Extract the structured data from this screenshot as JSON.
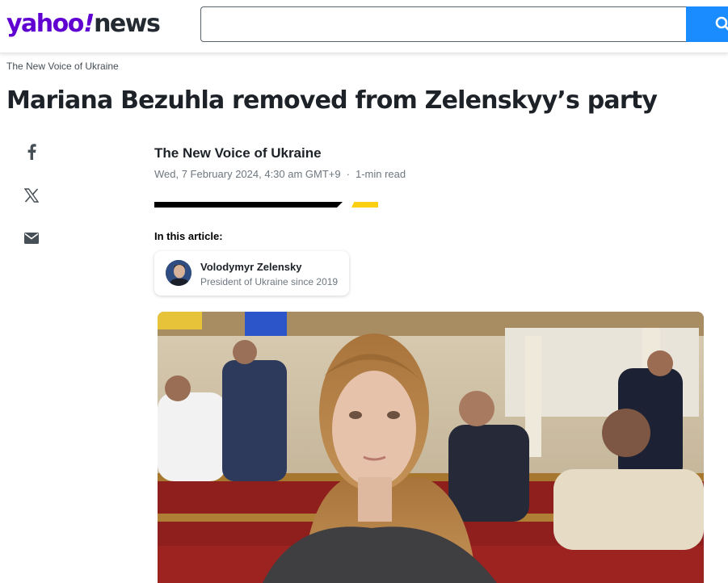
{
  "header": {
    "logo_main": "yahoo",
    "logo_bang": "!",
    "logo_section": "news",
    "search_value": "",
    "search_icon": "search-icon",
    "colors": {
      "brand": "#6001d2",
      "search_button": "#1a8cff"
    }
  },
  "article": {
    "provider_crumb": "The New Voice of Ukraine",
    "headline": "Mariana Bezuhla removed from Zelenskyy’s party",
    "byline": {
      "provider": "The New Voice of Ukraine",
      "date": "Wed, 7 February 2024, 4:30 am GMT+9",
      "separator": "·",
      "read_time": "1-min read"
    },
    "share": {
      "icons": [
        "facebook-icon",
        "x-icon",
        "email-icon"
      ]
    },
    "in_this_article": {
      "label": "In this article:",
      "entity": {
        "name": "Volodymyr Zelensky",
        "role": "President of Ukraine since 2019"
      }
    },
    "divider_colors": {
      "dark": "#000000",
      "accent": "#fcd012"
    }
  }
}
